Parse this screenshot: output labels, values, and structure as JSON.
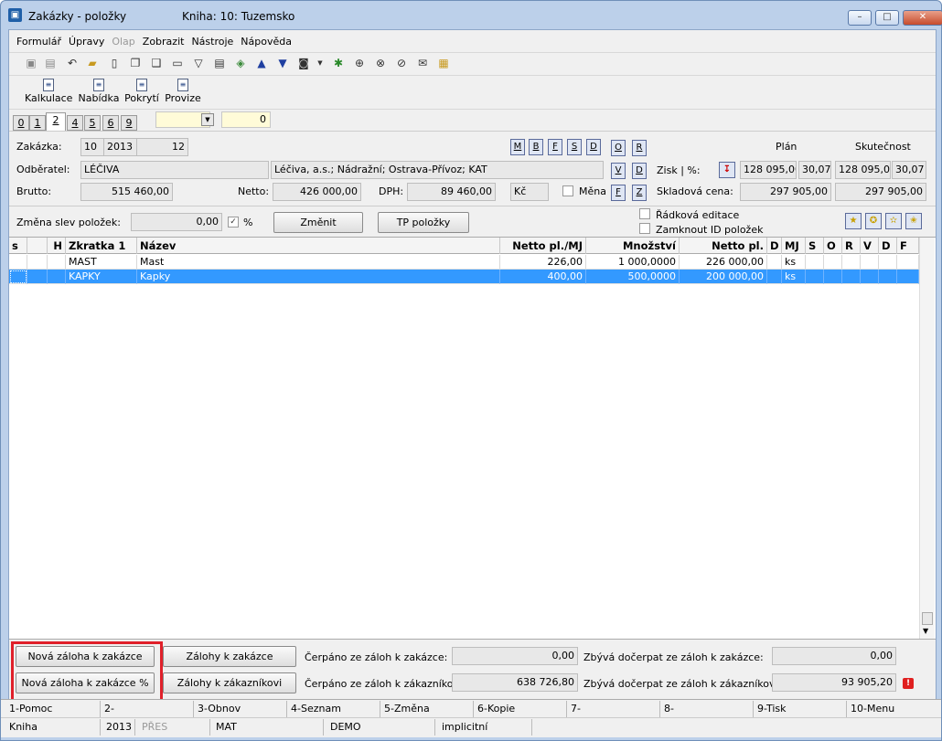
{
  "window": {
    "title": "Zakázky - položky",
    "book": "Kniha: 10: Tuzemsko",
    "minimize": "–",
    "maximize": "□",
    "close": "✕"
  },
  "menu": [
    "Formulář",
    "Úpravy",
    "Olap",
    "Zobrazit",
    "Nástroje",
    "Nápověda"
  ],
  "toolbar2": [
    {
      "label": "Kalkulace"
    },
    {
      "label": "Nabídka"
    },
    {
      "label": "Pokrytí"
    },
    {
      "label": "Provize"
    }
  ],
  "tabs": [
    "0",
    "1",
    "2",
    "4",
    "5",
    "6",
    "9"
  ],
  "tab_field_value": "0",
  "header": {
    "zakazka_label": "Zakázka:",
    "zakazka_book": "10",
    "zakazka_year": "2013",
    "zakazka_num": "12",
    "odberatel_label": "Odběratel:",
    "odberatel_code": "LÉČIVA",
    "odberatel_name": "Léčiva, a.s.; Nádražní; Ostrava-Přívoz; KAT",
    "brutto_label": "Brutto:",
    "brutto": "515 460,00",
    "netto_label": "Netto:",
    "netto": "426 000,00",
    "dph_label": "DPH:",
    "dph": "89 460,00",
    "currency": "Kč",
    "mena_label": "Měna",
    "letter_buttons": [
      "M",
      "B",
      "F",
      "S",
      "D"
    ],
    "side_buttons": [
      "O",
      "R",
      "V",
      "D",
      "F",
      "Z"
    ],
    "plan_label": "Plán",
    "skutecnost_label": "Skutečnost",
    "zisk_label": "Zisk | %:",
    "plan_zisk": "128 095,00",
    "plan_pct": "30,07",
    "skut_zisk": "128 095,00",
    "skut_pct": "30,07",
    "skladova_label": "Skladová cena:",
    "plan_sklad": "297 905,00",
    "skut_sklad": "297 905,00",
    "zmena_label": "Změna slev položek:",
    "zmena_value": "0,00",
    "pct_sign": "%",
    "zmenit_button": "Změnit",
    "tp_button": "TP položky",
    "radkova_label": "Řádková editace",
    "zamknout_label": "Zamknout ID položek"
  },
  "grid": {
    "columns": [
      "s",
      "H",
      "Zkratka 1",
      "Název",
      "Netto pl./MJ",
      "Množství",
      "Netto pl.",
      "D",
      "MJ",
      "S",
      "O",
      "R",
      "V",
      "D",
      "F"
    ],
    "rows": [
      {
        "zkratka": "MAST",
        "nazev": "Mast",
        "netto_mj": "226,00",
        "mnozstvi": "1 000,0000",
        "netto": "226 000,00",
        "mj": "ks"
      },
      {
        "zkratka": "KAPKY",
        "nazev": "Kapky",
        "netto_mj": "400,00",
        "mnozstvi": "500,0000",
        "netto": "200 000,00",
        "mj": "ks"
      }
    ]
  },
  "bottom": {
    "nova_zaloha": "Nová záloha k zakázce",
    "nova_zaloha_pct": "Nová záloha k zakázce %",
    "zalohy_zakazce": "Zálohy k zakázce",
    "zalohy_zakaznikovi": "Zálohy k zákazníkovi",
    "cerpano_zakazce_label": "Čerpáno ze záloh k zakázce:",
    "cerpano_zakazce": "0,00",
    "cerpano_zakaznikovi_label": "Čerpáno ze záloh k zákazníkovi:",
    "cerpano_zakaznikovi": "638 726,80",
    "zbyva_zakazce_label": "Zbývá dočerpat ze záloh k zakázce:",
    "zbyva_zakazce": "0,00",
    "zbyva_zakaznikovi_label": "Zbývá dočerpat ze záloh k zákazníkovi:",
    "zbyva_zakaznikovi": "93 905,20"
  },
  "fkeys": [
    "1-Pomoc",
    "2-",
    "3-Obnov",
    "4-Seznam",
    "5-Změna",
    "6-Kopie",
    "7-",
    "8-",
    "9-Tisk",
    "10-Menu"
  ],
  "status": [
    "Kniha",
    "2013",
    "PŘES",
    "MAT",
    "DEMO",
    "implicitní"
  ]
}
